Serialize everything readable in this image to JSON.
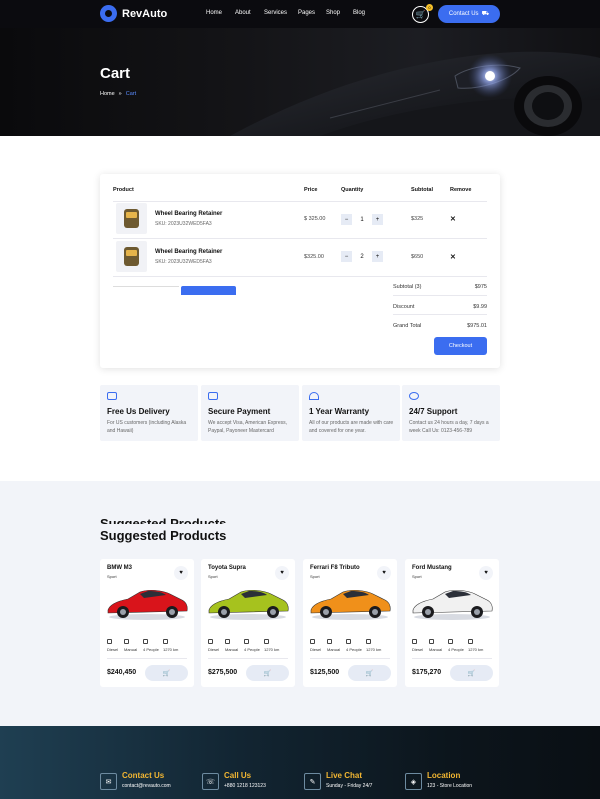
{
  "brand": {
    "name": "RevAuto",
    "accent": "#3b6df0",
    "highlight": "#f2b632"
  },
  "nav": {
    "items": [
      "Home",
      "About",
      "Services",
      "Pages",
      "Shop",
      "Blog"
    ],
    "cart_count": "0",
    "contact_label": "Contact Us"
  },
  "hero": {
    "title": "Cart",
    "breadcrumb": {
      "home": "Home",
      "separator": "»",
      "current": "Cart"
    }
  },
  "cart": {
    "headers": {
      "product": "Product",
      "price": "Price",
      "quantity": "Quantity",
      "subtotal": "Subtotal",
      "remove": "Remove"
    },
    "items": [
      {
        "name": "Wheel Bearing Retainer",
        "sku": "SKU: 2023U32WED5FA3",
        "price": "$ 325.00",
        "qty": "1",
        "subtotal": "$325",
        "remove": "✕"
      },
      {
        "name": "Wheel Bearing Retainer",
        "sku": "SKU: 2023U32WED5FA3",
        "price": "$325.00",
        "qty": "2",
        "subtotal": "$650",
        "remove": "✕"
      }
    ],
    "summary": {
      "subtotal_label": "Subtotal (3)",
      "subtotal_value": "$975",
      "discount_label": "Discount",
      "discount_value": "$9.99",
      "grand_label": "Grand Total",
      "grand_value": "$975.01"
    },
    "checkout_label": "Checkout"
  },
  "features": [
    {
      "icon": "truck-icon",
      "title": "Free Us Delivery",
      "desc": "For US customers (including Alaska and Hawaii)"
    },
    {
      "icon": "card-icon",
      "title": "Secure Payment",
      "desc": "We accept Visa, American Express, Paypal, Payoneer Mastercard"
    },
    {
      "icon": "umbrella-icon",
      "title": "1 Year Warranty",
      "desc": "All of our products are made with care and covered for one year."
    },
    {
      "icon": "headset-icon",
      "title": "24/7 Support",
      "desc": "Contact us 24 hours a day, 7 days a week Call Us: 0123-456-789"
    }
  ],
  "suggested": {
    "title": "Suggested Products",
    "spec_labels": [
      "Diesel",
      "Manual",
      "4 People",
      "1270 km"
    ],
    "products": [
      {
        "name": "BMW M3",
        "type": "Sport",
        "price": "$240,450",
        "color": "#d9141b"
      },
      {
        "name": "Toyota Supra",
        "type": "Sport",
        "price": "$275,500",
        "color": "#a6c21e"
      },
      {
        "name": "Ferrari F8 Tributo",
        "type": "Sport",
        "price": "$125,500",
        "color": "#f0901a"
      },
      {
        "name": "Ford Mustang",
        "type": "Sport",
        "price": "$175,270",
        "color": "#f1f1f1"
      }
    ]
  },
  "footer": {
    "items": [
      {
        "icon": "mail-icon",
        "title": "Contact Us",
        "text": "contact@revauto.com"
      },
      {
        "icon": "phone-icon",
        "title": "Call Us",
        "text": "+880 1218 123123"
      },
      {
        "icon": "chat-icon",
        "title": "Live Chat",
        "text": "Sunday - Friday 24/7"
      },
      {
        "icon": "location-icon",
        "title": "Location",
        "text": "123 - Store Location"
      }
    ]
  }
}
